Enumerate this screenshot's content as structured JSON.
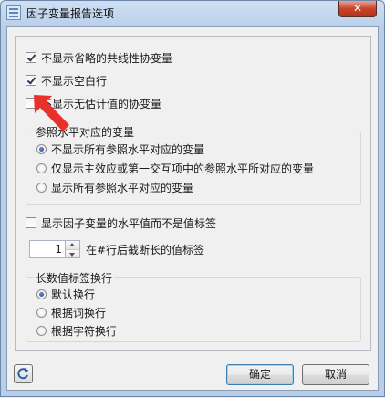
{
  "window": {
    "title": "因子变量报告选项",
    "close_glyph": "✕"
  },
  "options": {
    "hide_redundant": {
      "label": "不显示省略的共线性协变量",
      "checked": true
    },
    "hide_blank_rows": {
      "label": "不显示空白行",
      "checked": true
    },
    "hide_inestimable": {
      "label": "不显示无估计值的协变量",
      "checked": false
    }
  },
  "reference_group": {
    "legend": "参照水平对应的变量",
    "items": [
      {
        "label": "不显示所有参照水平对应的变量",
        "checked": true
      },
      {
        "label": "仅显示主效应或第一交互项中的参照水平所对应的变量",
        "checked": false
      },
      {
        "label": "显示所有参照水平对应的变量",
        "checked": false
      }
    ]
  },
  "show_level_values": {
    "label": "显示因子变量的水平值而不是值标签",
    "checked": false
  },
  "truncate": {
    "value": "1",
    "label": "在#行后截断长的值标签"
  },
  "wrap_group": {
    "legend": "长数值标签换行",
    "items": [
      {
        "label": "默认换行",
        "checked": true
      },
      {
        "label": "根据词换行",
        "checked": false
      },
      {
        "label": "根据字符换行",
        "checked": false
      }
    ]
  },
  "buttons": {
    "ok": "确定",
    "cancel": "取消"
  },
  "icons": {
    "refresh": "refresh-icon",
    "app": "window-app-icon",
    "annotation": "red-arrow-icon"
  },
  "colors": {
    "annotation_arrow": "#e8312a",
    "checked_radio": "#1f3e8a"
  }
}
